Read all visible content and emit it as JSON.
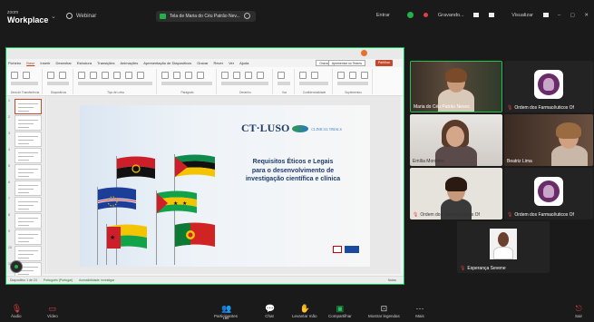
{
  "topbar": {
    "brand_small": "zoom",
    "brand_big": "Workplace",
    "webinar": "Webinar",
    "share_label": "Tela de Maria do Céu Patrão Nev...",
    "enter": "Entrar",
    "recording": "Gravando...",
    "view": "Visualizar"
  },
  "ppt": {
    "menu": [
      "Ficheiro",
      "Base",
      "Inserir",
      "Desenhar",
      "Estrutura",
      "Transições",
      "Animações",
      "Apresentação de Diapositivos",
      "Gravar",
      "Rever",
      "Ver",
      "Ajuda"
    ],
    "record_btn": "Gravar",
    "present_btn": "Apresentar no Teams",
    "share_btn": "Partilhar",
    "ribbon_groups": [
      "Área de Transferência",
      "Diapositivos",
      "Tipo de Letra",
      "Parágrafo",
      "Desenho",
      "Voz",
      "Confidencialidade",
      "Suplementos"
    ],
    "status_left": "Diapositivo 1 de 24",
    "status_lang": "Português (Portugal)",
    "status_accessibility": "Acessibilidade: investigar",
    "status_zoom": "Notas"
  },
  "slide": {
    "logo_text": "CT·LUSO",
    "logo_sub": "CLINICAL TRIALS",
    "title_lines": [
      "Requisitos Éticos e Legais",
      "para o desenvolvimento de",
      "investigação científica e clínica"
    ]
  },
  "participants": [
    {
      "name": "Maria do Céu Patrão Neves",
      "muted": false
    },
    {
      "name": "Ordem dos Farmacêuticos Of",
      "muted": true
    },
    {
      "name": "Emília Monteiro",
      "muted": false
    },
    {
      "name": "Beatriz Lima",
      "muted": false
    },
    {
      "name": "Ordem dos Farmacêuticos Of",
      "muted": true
    },
    {
      "name": "Ordem dos Farmacêuticos Of",
      "muted": true
    },
    {
      "name": "Esperança Sevene",
      "muted": true
    }
  ],
  "bottombar": {
    "audio": "Áudio",
    "video": "Vídeo",
    "participants": "Participantes",
    "participants_count": "185",
    "chat": "Chat",
    "raise_hand": "Levantar mão",
    "share": "Compartilhar",
    "more_apps": "Mostrar legendas",
    "more": "Mais",
    "leave": "Sair"
  },
  "colors": {
    "active_speaker": "#23c055",
    "ppt_accent": "#c34a2c",
    "slide_title": "#1f3d6b"
  }
}
